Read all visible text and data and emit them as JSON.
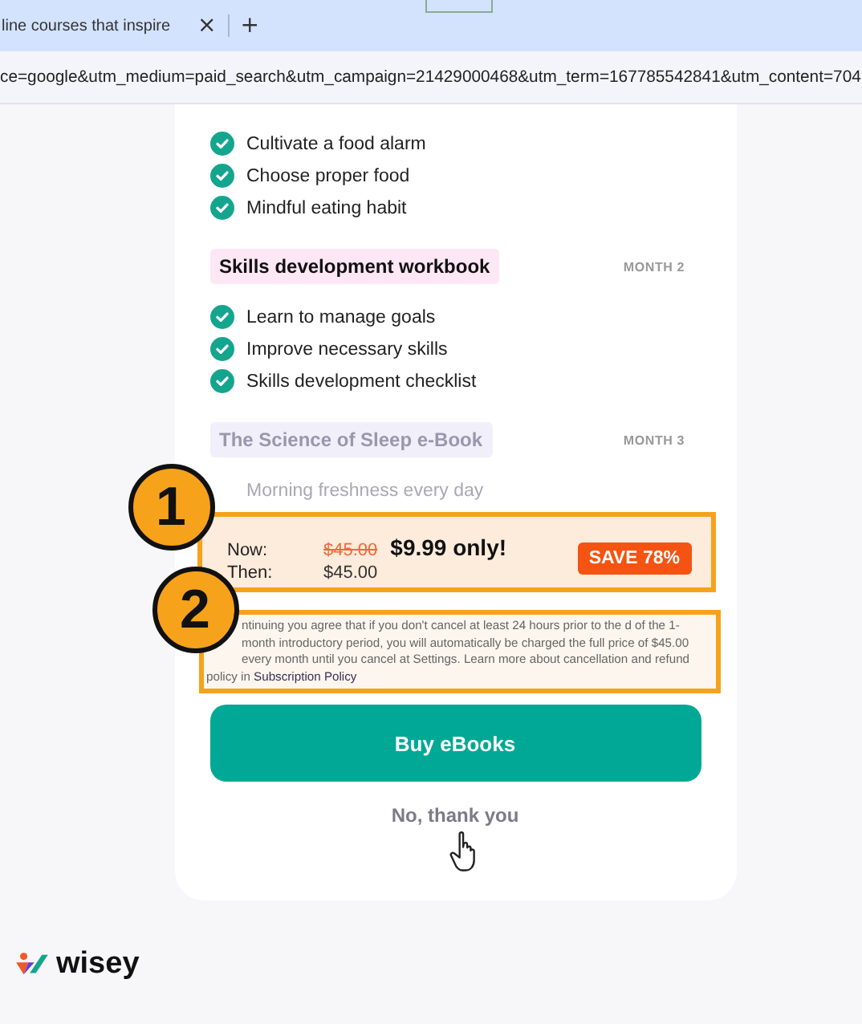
{
  "browser": {
    "tab_title": "line courses that inspire",
    "close": "×",
    "new_tab": "+",
    "url": "ce=google&utm_medium=paid_search&utm_campaign=21429000468&utm_term=167785542841&utm_content=704"
  },
  "sections": [
    {
      "faded": false,
      "items": [
        "Cultivate a food alarm",
        "Choose proper food",
        "Mindful eating habit"
      ]
    },
    {
      "title": "Skills development workbook",
      "month": "MONTH 2",
      "faded": false,
      "items": [
        "Learn to manage goals",
        "Improve necessary skills",
        "Skills development checklist"
      ]
    },
    {
      "title": "The Science of Sleep e-Book",
      "month": "MONTH 3",
      "faded": true,
      "items": [
        "Morning freshness every day"
      ]
    }
  ],
  "price": {
    "now_label": "Now:",
    "old_price": "$45.00",
    "new_price": "$9.99 only!",
    "then_label": "Then:",
    "then_price": "$45.00",
    "badge": "SAVE 78%",
    "marker": "1"
  },
  "disclaimer": {
    "marker": "2",
    "text": "ntinuing you agree that if you don't cancel at least 24 hours prior to the d of the 1-month introductory period, you will automatically be charged the full price of $45.00 every month until you cancel at Settings. Learn more about cancellation and refund policy in",
    "link": "Subscription Policy"
  },
  "buy_button": "Buy eBooks",
  "decline": "No, thank you",
  "logo": "wisey"
}
